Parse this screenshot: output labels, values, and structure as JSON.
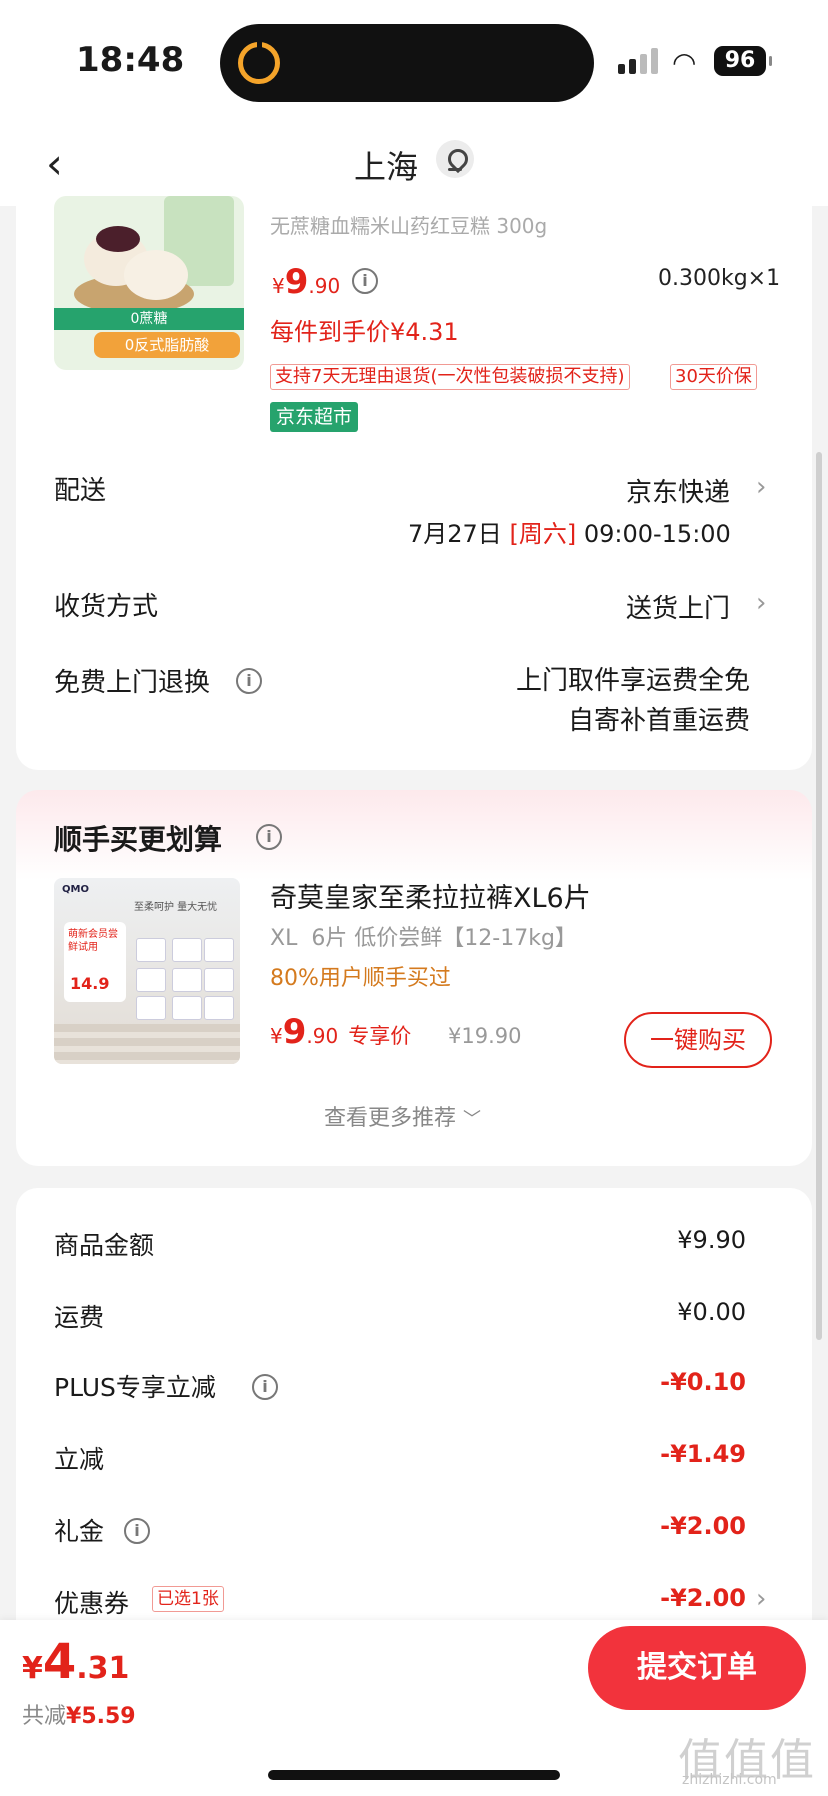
{
  "status_bar": {
    "time": "18:48",
    "battery": "96"
  },
  "nav": {
    "title": "上海"
  },
  "product": {
    "name": "无蔗糖血糯米山药红豆糕 300g",
    "price_symbol": "¥",
    "price_int": "9",
    "price_dec": ".90",
    "weight_qty": "0.300kg×1",
    "unit_price": "每件到手价¥4.31",
    "tag_return": "支持7天无理由退货(一次性包装破损不支持)",
    "tag_price_protect": "30天价保",
    "tag_store": "京东超市",
    "thumb_tag_green": "0蔗糖",
    "thumb_tag_orange": "0反式脂肪酸"
  },
  "delivery": {
    "label": "配送",
    "carrier": "京东快递",
    "date": "7月27日",
    "weekday": "[周六]",
    "time_range": "09:00-15:00"
  },
  "receive": {
    "label": "收货方式",
    "value": "送货上门"
  },
  "free_return": {
    "label": "免费上门退换",
    "line1": "上门取件享运费全免",
    "line2": "自寄补首重运费"
  },
  "recommend": {
    "title": "顺手买更划算",
    "item_name": "奇莫皇家至柔拉拉裤XL6片",
    "item_spec": "XL  6片 低价尝鲜【12-17kg】",
    "item_hint": "80%用户顺手买过",
    "price_symbol": "¥",
    "price_int": "9",
    "price_dec": ".90",
    "price_tag": "专享价",
    "orig_price": "¥19.90",
    "buy_button": "一键购买",
    "more": "查看更多推荐",
    "thumb_brand": "QMO",
    "thumb_slogan": "至柔呵护  量大无忧",
    "thumb_badge": "萌新会员尝鲜试用",
    "thumb_price": "14.9"
  },
  "summary": {
    "rows": [
      {
        "label": "商品金额",
        "value": "¥9.90"
      },
      {
        "label": "运费",
        "value": "¥0.00"
      },
      {
        "label": "PLUS专享立减",
        "value": "-¥0.10"
      },
      {
        "label": "立减",
        "value": "-¥1.49"
      },
      {
        "label": "礼金",
        "value": "-¥2.00"
      },
      {
        "label": "优惠券",
        "value": "-¥2.00",
        "badge": "已选1张"
      }
    ]
  },
  "bottom": {
    "total_symbol": "¥",
    "total_int": "4",
    "total_dec": ".31",
    "saved_label": "共减",
    "saved_value": "¥5.59",
    "submit": "提交订单"
  },
  "watermark": {
    "main": "值值值",
    "sub": "zhizhizhi.com"
  },
  "colors": {
    "accent": "#e2231a",
    "button": "#f2333c",
    "store_tag": "#26a36d"
  }
}
